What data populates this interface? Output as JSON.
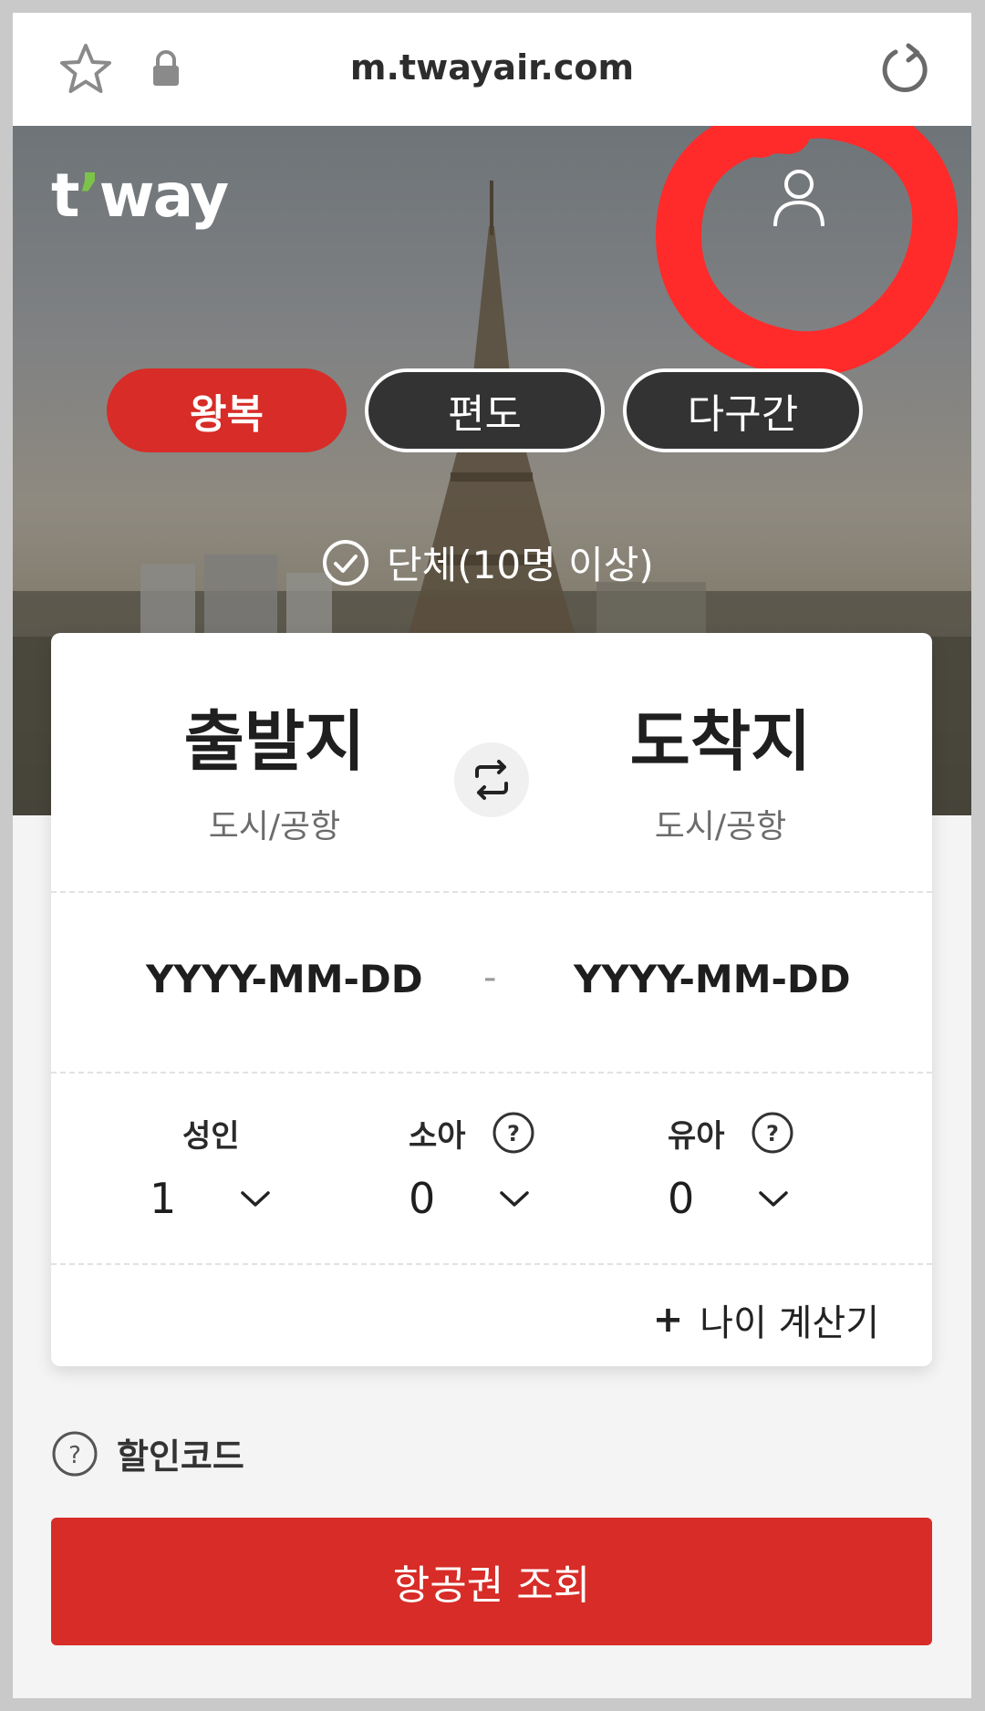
{
  "browser": {
    "url": "m.twayair.com",
    "icons": [
      "star-icon",
      "lock-icon",
      "reload-icon"
    ]
  },
  "header": {
    "logo_text_t": "t",
    "logo_text_way": "way",
    "user_icon": "user-icon"
  },
  "trip_types": [
    {
      "label": "왕복",
      "active": true
    },
    {
      "label": "편도",
      "active": false
    },
    {
      "label": "다구간",
      "active": false
    }
  ],
  "group_booking": {
    "label": "단체(10명 이상)"
  },
  "route": {
    "origin_title": "출발지",
    "origin_sub": "도시/공항",
    "destination_title": "도착지",
    "destination_sub": "도시/공항"
  },
  "dates": {
    "start": "YYYY-MM-DD",
    "separator": "-",
    "end": "YYYY-MM-DD"
  },
  "passengers": {
    "adult_label": "성인",
    "adult_value": "1",
    "child_label": "소아",
    "child_value": "0",
    "infant_label": "유아",
    "infant_value": "0"
  },
  "age_calculator": {
    "plus": "+",
    "label": "나이 계산기"
  },
  "discount_code": {
    "label": "할인코드"
  },
  "search_button": {
    "label": "항공권 조회"
  },
  "colors": {
    "accent": "#d72c27",
    "annotation": "#ff2b2b",
    "inactive_tab": "#333333"
  }
}
